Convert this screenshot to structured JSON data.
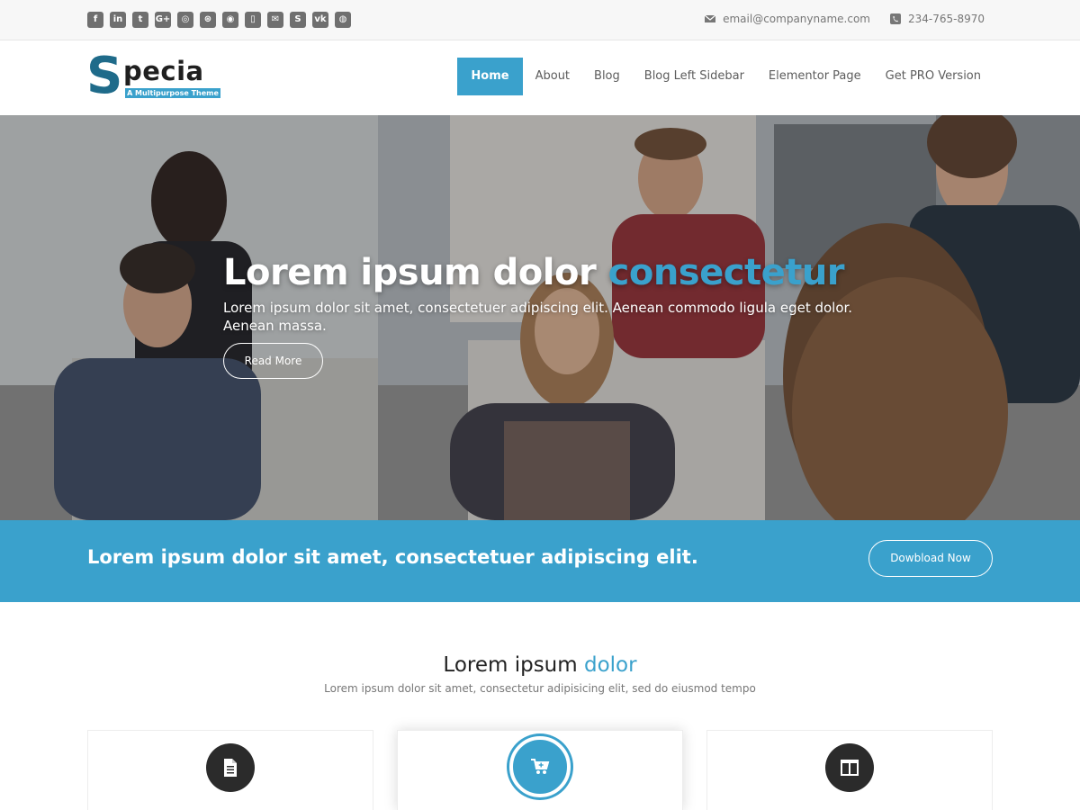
{
  "topbar": {
    "social_icons": [
      "facebook-icon",
      "linkedin-icon",
      "twitter-icon",
      "google-plus-icon",
      "instagram-icon",
      "dribbble-icon",
      "github-icon",
      "foursquare-icon",
      "email-icon",
      "skype-icon",
      "vk-icon",
      "pinterest-icon"
    ],
    "social_glyphs": [
      "f",
      "in",
      "t",
      "G+",
      "◎",
      "⊛",
      "◉",
      "▯",
      "✉",
      "S",
      "vk",
      "◍"
    ],
    "email": "email@companyname.com",
    "phone": "234-765-8970"
  },
  "header": {
    "logo_s": "S",
    "logo_rest": "pecia",
    "logo_tagline": "A Multipurpose Theme",
    "nav": [
      {
        "label": "Home",
        "active": true
      },
      {
        "label": "About",
        "active": false
      },
      {
        "label": "Blog",
        "active": false
      },
      {
        "label": "Blog Left Sidebar",
        "active": false
      },
      {
        "label": "Elementor Page",
        "active": false
      },
      {
        "label": "Get PRO Version",
        "active": false
      }
    ]
  },
  "hero": {
    "title_main": "Lorem ipsum dolor",
    "title_accent": "consectetur",
    "subtitle": "Lorem ipsum dolor sit amet, consectetuer adipiscing elit. Aenean commodo ligula eget dolor. Aenean massa.",
    "button_label": "Read More"
  },
  "cta": {
    "text": "Lorem ipsum dolor sit amet, consectetuer adipiscing elit.",
    "button_label": "Dowbload Now"
  },
  "section": {
    "title_main": "Lorem ipsum",
    "title_accent": "dolor",
    "subtitle": "Lorem ipsum dolor sit amet, consectetur adipisicing elit, sed do eiusmod tempo",
    "cards": [
      {
        "icon": "document-icon"
      },
      {
        "icon": "cart-icon"
      },
      {
        "icon": "columns-icon"
      }
    ]
  },
  "colors": {
    "accent": "#3aa1cc",
    "dark": "#2b2b2b"
  }
}
